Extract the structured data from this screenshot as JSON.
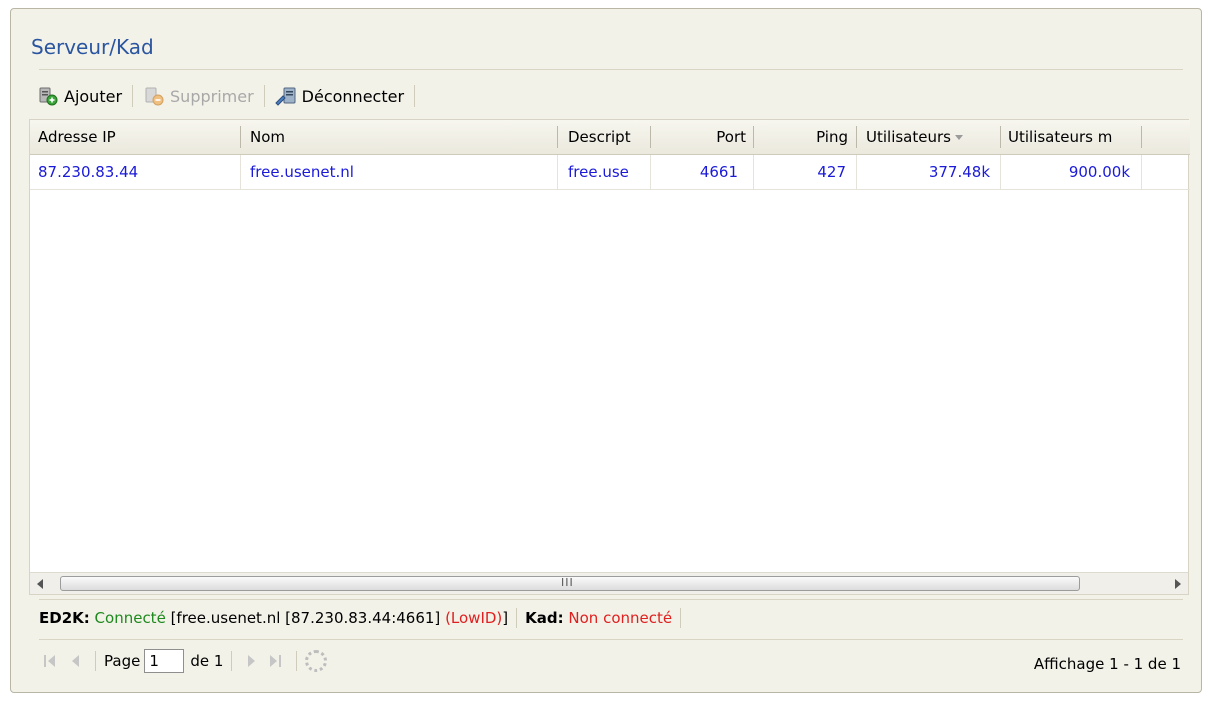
{
  "panel": {
    "title": "Serveur/Kad"
  },
  "toolbar": {
    "add_label": "Ajouter",
    "remove_label": "Supprimer",
    "disconnect_label": "Déconnecter"
  },
  "grid": {
    "columns": [
      "Adresse IP",
      "Nom",
      "Descript",
      "Port",
      "Ping",
      "Utilisateurs",
      "Utilisateurs m"
    ],
    "rows": [
      {
        "ip": "87.230.83.44",
        "name": "free.usenet.nl",
        "desc": "free.use",
        "port": "4661",
        "ping": "427",
        "users": "377.48k",
        "max_users": "900.00k"
      }
    ],
    "scroll_grip": "III"
  },
  "status": {
    "ed2k_label": "ED2K:",
    "ed2k_state": "Connecté",
    "ed2k_server": "[free.usenet.nl [87.230.83.44:4661]",
    "ed2k_lowid": "(LowID)",
    "ed2k_close": "]",
    "kad_label": "Kad:",
    "kad_state": "Non connecté"
  },
  "pager": {
    "page_label": "Page",
    "page_value": "1",
    "of_label": "de 1",
    "display_info": "Affichage 1 - 1 de 1"
  },
  "colors": {
    "link": "#1a1ad8",
    "connected": "#1e8a1e",
    "error": "#e02020",
    "title": "#2a55a0"
  }
}
